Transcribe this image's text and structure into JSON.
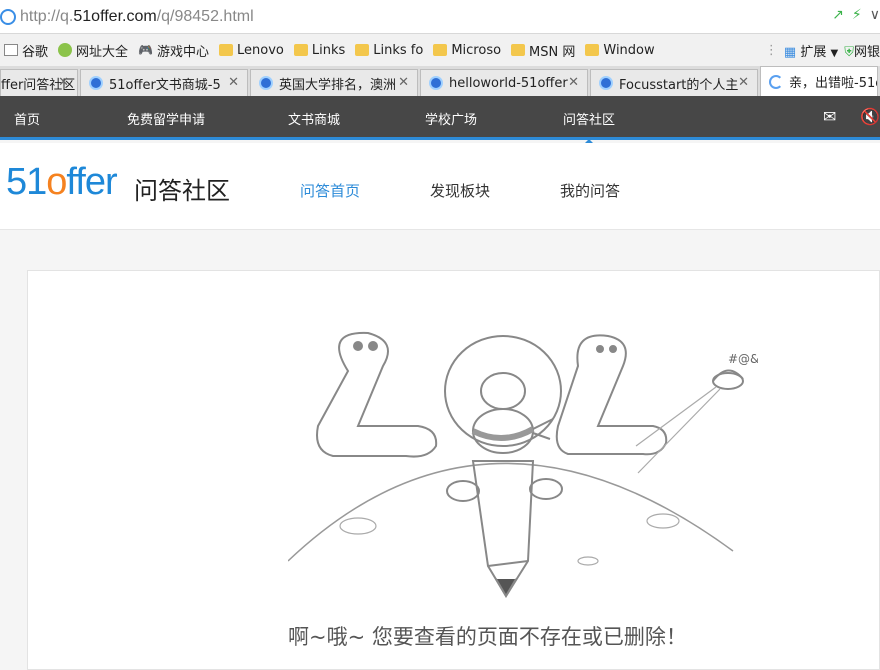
{
  "address_bar": {
    "url_prefix": "http://q.",
    "url_domain": "51offer.com",
    "url_path": "/q/98452.html"
  },
  "bookmarks": [
    {
      "label": "谷歌",
      "icon": "page-icon"
    },
    {
      "label": "网址大全",
      "icon": "hao-icon"
    },
    {
      "label": "游戏中心",
      "icon": "gamepad-icon"
    },
    {
      "label": "Lenovo",
      "icon": "folder-icon"
    },
    {
      "label": "Links",
      "icon": "folder-icon"
    },
    {
      "label": "Links fo",
      "icon": "folder-icon"
    },
    {
      "label": "Microso",
      "icon": "folder-icon"
    },
    {
      "label": "MSN 网",
      "icon": "folder-icon"
    },
    {
      "label": "Window",
      "icon": "folder-icon"
    }
  ],
  "bookmarks_right": {
    "extend": "扩展",
    "wangyin": "网银"
  },
  "tabs": [
    {
      "label": "ffer问答社区"
    },
    {
      "label": "51offer文书商城-5"
    },
    {
      "label": "英国大学排名，澳洲"
    },
    {
      "label": "helloworld-51offer"
    },
    {
      "label": "Focusstart的个人主"
    },
    {
      "label": "亲，出错啦-51offer"
    }
  ],
  "nav": {
    "items": [
      "首页",
      "免费留学申请",
      "文书商城",
      "学校广场",
      "问答社区"
    ]
  },
  "header": {
    "logo_51": "51",
    "logo_o": "o",
    "logo_ffer": "ffer",
    "title": "问答社区",
    "sub_nav": [
      "问答首页",
      "发现板块",
      "我的问答"
    ]
  },
  "illustration": {
    "error_code": "404",
    "symbols": "#@&"
  },
  "message": "啊~哦~ 您要查看的页面不存在或已删除！",
  "colors": {
    "accent": "#2d8bd8",
    "nav_bg": "#474747",
    "logo_o": "#f58220"
  }
}
